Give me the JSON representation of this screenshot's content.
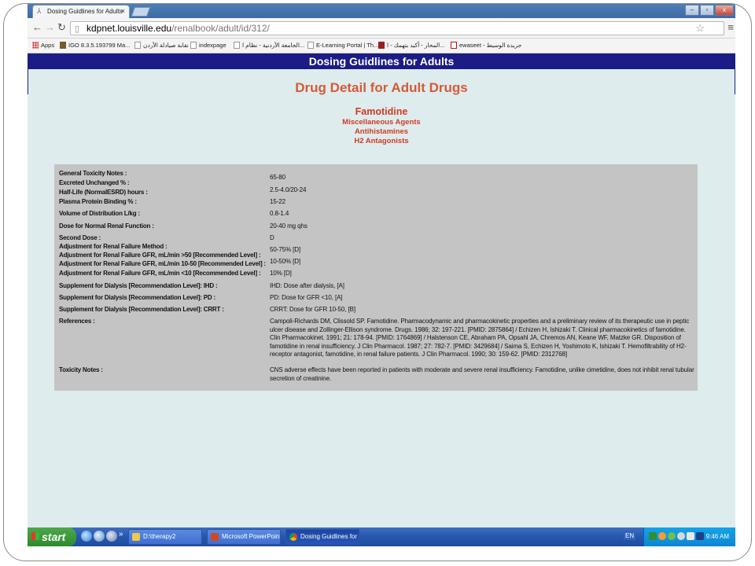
{
  "browser": {
    "tab_title": "Dosing Guidlines for Adults",
    "tab_close": "×",
    "window_buttons": [
      "–",
      "▫",
      "x"
    ],
    "url_host": "kdpnet.louisville.edu",
    "url_path": "/renalbook/adult/id/312/",
    "bookmarks": [
      "Apps",
      "IGO 8.3.5.193799 Ma...",
      "نقابة صيادلة الأردن",
      "indexpage",
      "الجامعة الأردنية - نظام ا...",
      "E-Learning Portal | Th...",
      "المحار - أكيد بتهمك - ا...",
      "ewaseet - جريدة الوسيط"
    ]
  },
  "page": {
    "banner": "Dosing Guidlines for Adults",
    "title": "Drug Detail for Adult Drugs",
    "drug_name": "Famotidine",
    "classes": [
      "Miscellaneous Agents",
      "Antihistamines",
      "H2 Antagonists"
    ],
    "details": [
      {
        "label": "General Toxicity Notes :",
        "value": ""
      },
      {
        "label": "Excreted Unchanged % :",
        "value": "65-80"
      },
      {
        "label": "Half-Life (NormalESRD) hours :",
        "value": "2.5-4.0/20-24"
      },
      {
        "label": "Plasma Protein Binding % :",
        "value": "15-22"
      },
      {
        "label": "Volume of Distribution L/kg :",
        "value": "0.8-1.4"
      },
      {
        "label": "Dose for Normal Renal Function :",
        "value": "20-40 mg qhs"
      },
      {
        "label": "Second Dose :",
        "value": "D"
      },
      {
        "label": "Adjustment for Renal Failure Method :",
        "value": ""
      },
      {
        "label": "Adjustment for Renal Failure GFR, mL/min >50 [Recommended Level] :",
        "value": "50-75% [D]"
      },
      {
        "label": "Adjustment for Renal Failure GFR, mL/min 10-50 [Recommended Level] :",
        "value": "10-50% [D]"
      },
      {
        "label": "Adjustment for Renal Failure GFR, mL/min <10 [Recommended Level] :",
        "value": "10% [D]"
      },
      {
        "label": "Supplement for Dialysis [Recommendation Level]: IHD :",
        "value": "IHD: Dose after dialysis, [A]"
      },
      {
        "label": "Supplement for Dialysis [Recommendation Level]: PD :",
        "value": "PD: Dose for GFR <10, [A]"
      },
      {
        "label": "Supplement for Dialysis [Recommendation Level]: CRRT :",
        "value": "CRRT: Dose for GFR 10-50, [B]"
      },
      {
        "label": "References :",
        "value": "Campoli-Richards DM, Clissold SP. Famotidine. Pharmacodynamic and pharmacokinetic properties and a preliminary review of its therapeutic use in peptic ulcer disease and Zollinger-Ellison syndrome. Drugs. 1986; 32: 197-221. [PMID: 2875864] / Echizen H, Ishizaki T. Clinical pharmacokinetics of famotidine. Clin Pharmacokinet. 1991; 21: 178-94. [PMID: 1764869] / Halstenson CE, Abraham PA, Opsahl JA, Chremos AN, Keane WF, Matzke GR. Disposition of famotidine in renal insufficiency. J Clin Pharmacol. 1987; 27: 782-7. [PMID: 3429684] / Saima S, Echizen H, Yoshimoto K, Ishizaki T. Hemofiltrability of H2-receptor antagonist, famotidine, in renal failure patients. J Clin Pharmacol. 1990; 30: 159-62. [PMID: 2312768]"
      },
      {
        "label": "Toxicity Notes :",
        "value": "CNS adverse effects have been reported in patients with moderate and severe renal insufficiency. Famotidine, unlike cimetidine, does not inhibit renal tubular secretion of creatinine."
      }
    ]
  },
  "taskbar": {
    "start_label": "start",
    "more_glyph": "»",
    "items": [
      "D:\\therapy2",
      "Microsoft PowerPoint ...",
      "Dosing Guidlines for A..."
    ],
    "language": "EN",
    "clock": "9:46 AM"
  },
  "colors": {
    "banner": "#1c1c86",
    "title": "#d65a38",
    "drug": "#cf3b23",
    "panel": "#c4c4c4",
    "page_bg": "#dfeced"
  }
}
